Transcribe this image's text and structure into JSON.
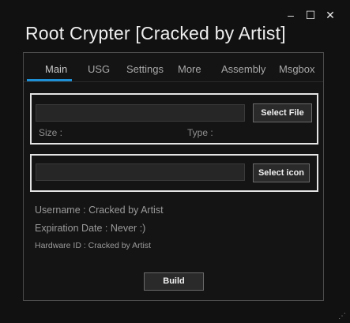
{
  "window": {
    "title": "Root Crypter [Cracked by Artist]",
    "minimize_symbol": "–",
    "maximize_symbol": "☐",
    "close_symbol": "✕",
    "resize_grip_symbol": "⋰"
  },
  "tabs": [
    {
      "label": "Main",
      "active": true
    },
    {
      "label": "USG",
      "active": false
    },
    {
      "label": "Settings",
      "active": false
    },
    {
      "label": "More",
      "active": false
    },
    {
      "label": "Assembly",
      "active": false
    },
    {
      "label": "Msgbox",
      "active": false
    }
  ],
  "file_section": {
    "path_value": "",
    "select_label": "Select File",
    "size_label": "Size :",
    "type_label": "Type :"
  },
  "icon_section": {
    "path_value": "",
    "select_label": "Select icon"
  },
  "info": {
    "username": "Username : Cracked by Artist",
    "expiration": "Expiration Date : Never :)",
    "hardware_id": "Hardware ID : Cracked by Artist"
  },
  "build_label": "Build",
  "colors": {
    "background": "#111111",
    "accent": "#1e90d6",
    "box_border": "#e4e4e4"
  }
}
